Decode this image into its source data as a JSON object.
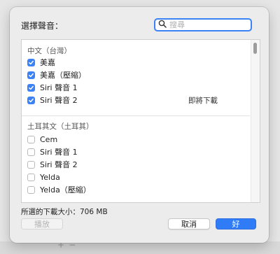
{
  "dialog": {
    "title": "選擇聲音：",
    "search": {
      "placeholder": "搜尋",
      "icon": "search-icon"
    },
    "sections": [
      {
        "header": "中文（台灣）",
        "items": [
          {
            "label": "美嘉",
            "checked": true,
            "status": ""
          },
          {
            "label": "美嘉（壓縮）",
            "checked": true,
            "status": ""
          },
          {
            "label": "Siri 聲音 1",
            "checked": true,
            "status": ""
          },
          {
            "label": "Siri 聲音 2",
            "checked": true,
            "status": "即將下載"
          }
        ]
      },
      {
        "header": "土耳其文（土耳其）",
        "items": [
          {
            "label": "Cem",
            "checked": false,
            "status": ""
          },
          {
            "label": "Siri 聲音 1",
            "checked": false,
            "status": ""
          },
          {
            "label": "Siri 聲音 2",
            "checked": false,
            "status": ""
          },
          {
            "label": "Yelda",
            "checked": false,
            "status": ""
          },
          {
            "label": "Yelda（壓縮）",
            "checked": false,
            "status": ""
          }
        ]
      }
    ],
    "download_size": "所選的下載大小：706 MB",
    "buttons": {
      "play": "播放",
      "cancel": "取消",
      "ok": "好"
    }
  },
  "backdrop": {
    "add": "+",
    "remove": "−"
  },
  "colors": {
    "accent": "#3b82f6",
    "ok_button": "#2f7cf6"
  }
}
